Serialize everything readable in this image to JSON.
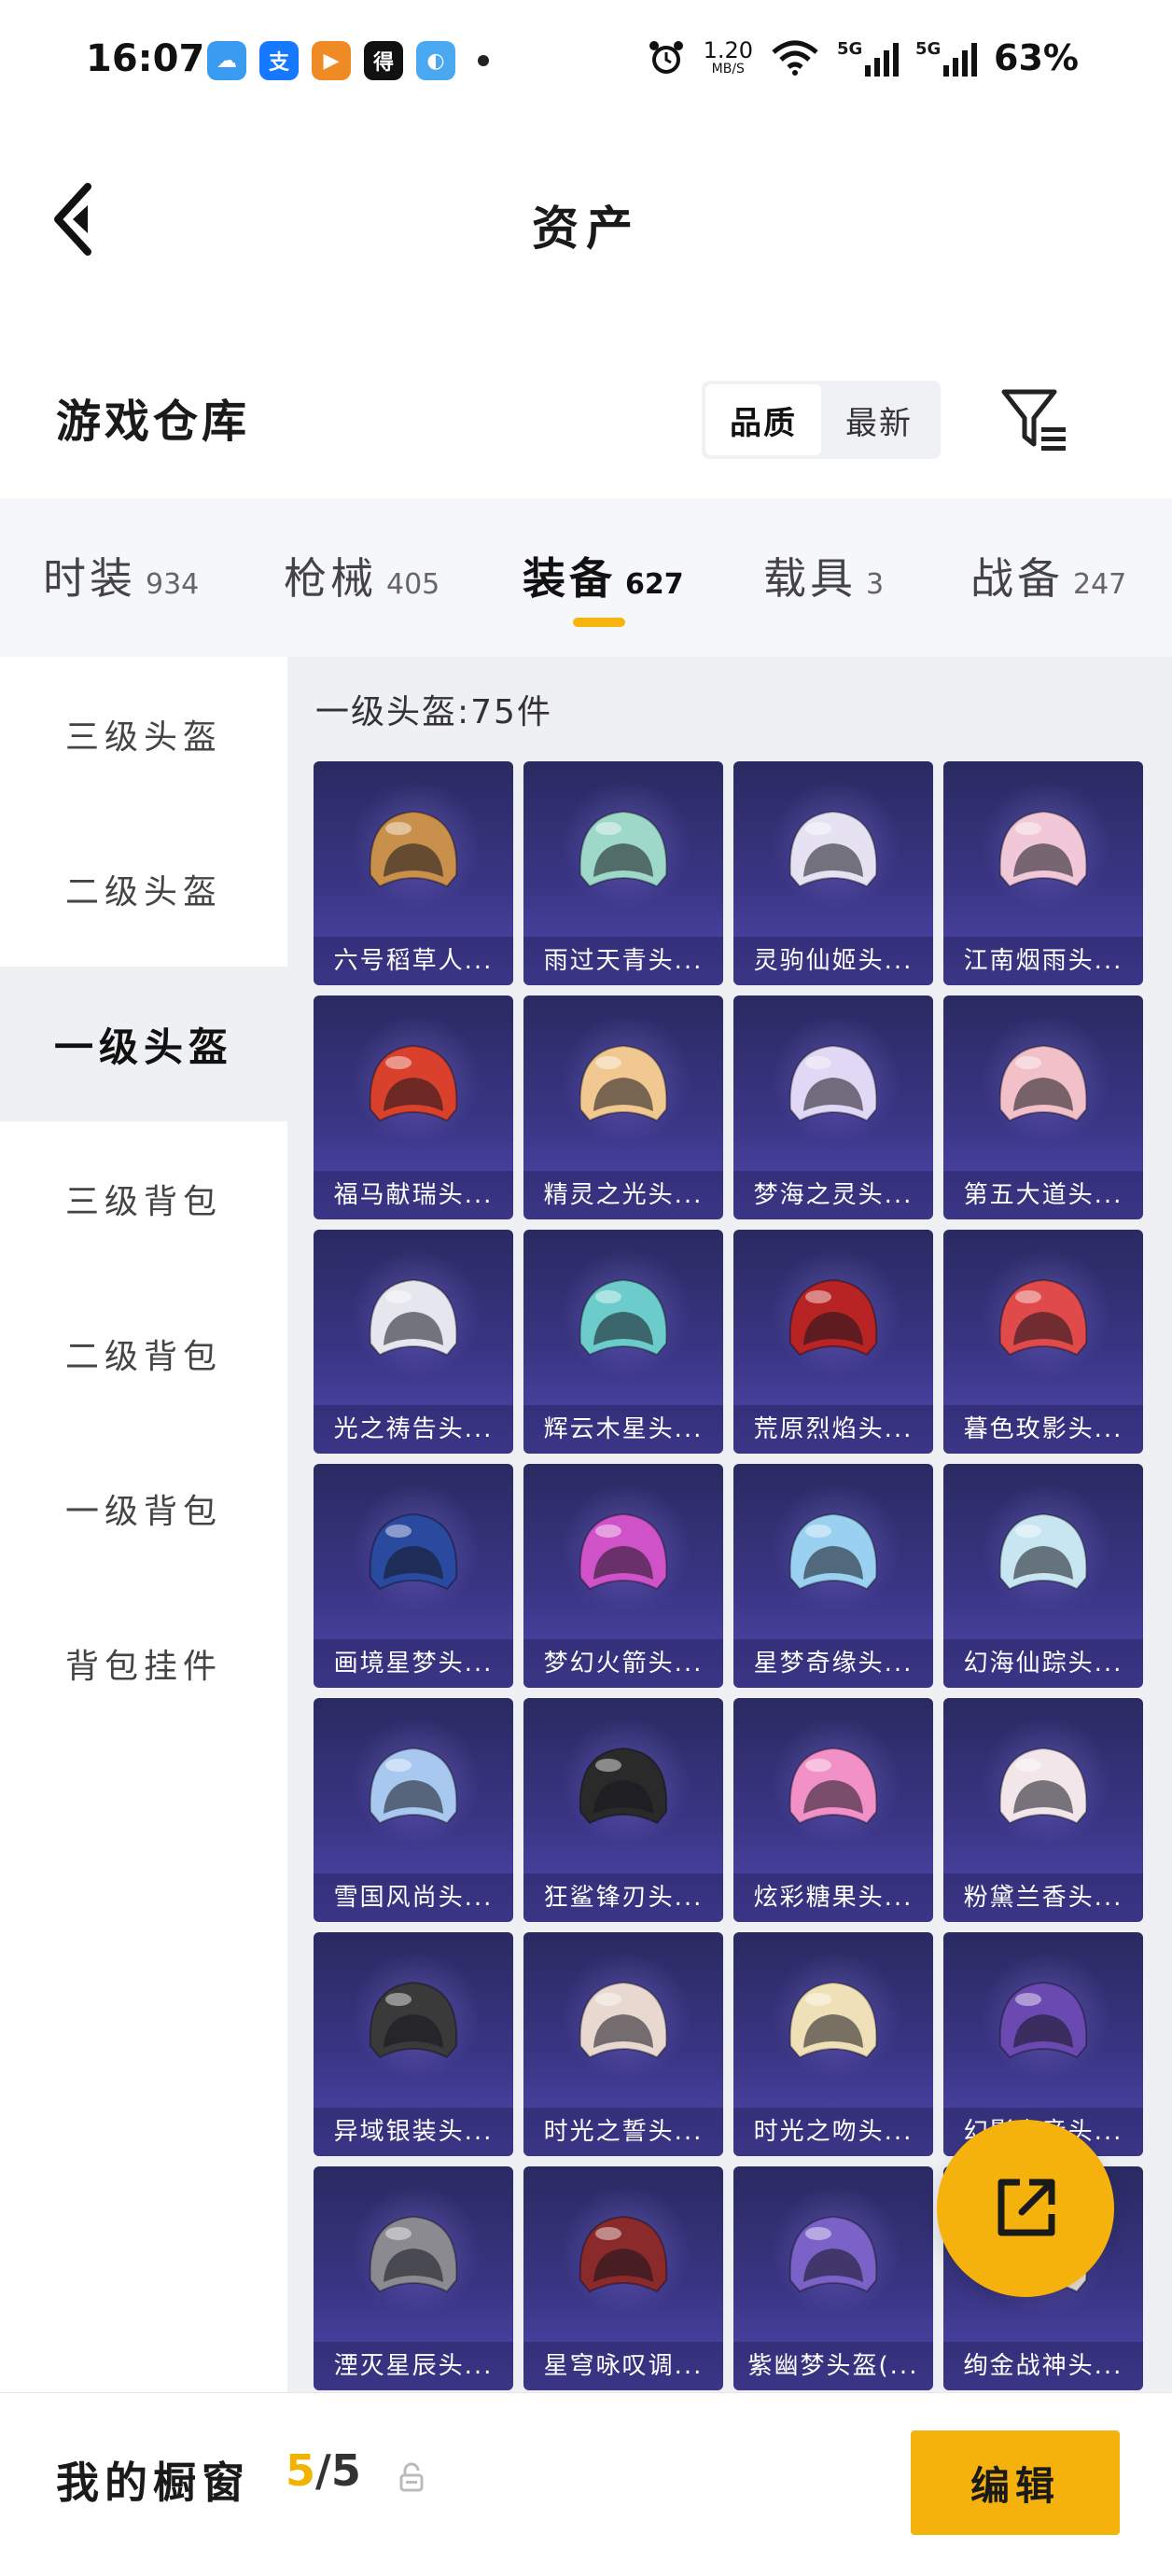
{
  "status_bar": {
    "time": "16:07",
    "app_icons": [
      "weather-icon",
      "alipay-icon",
      "video-app-icon",
      "dewu-icon",
      "qq-browser-icon"
    ],
    "net_speed_value": "1.20",
    "net_speed_unit": "MB/S",
    "sim1_label": "5G",
    "sim2_label": "5G",
    "battery": "63%"
  },
  "header": {
    "title": "资产"
  },
  "warehouse": {
    "title": "游戏仓库",
    "sort_options": [
      "品质",
      "最新"
    ],
    "active_sort": 0
  },
  "categories": [
    {
      "label": "时装",
      "count": "934"
    },
    {
      "label": "枪械",
      "count": "405"
    },
    {
      "label": "装备",
      "count": "627"
    },
    {
      "label": "载具",
      "count": "3"
    },
    {
      "label": "战备",
      "count": "247"
    }
  ],
  "active_category": 2,
  "sidebar": {
    "items": [
      "三级头盔",
      "二级头盔",
      "一级头盔",
      "三级背包",
      "二级背包",
      "一级背包",
      "背包挂件"
    ],
    "active": 2
  },
  "content": {
    "heading": "一级头盔:75件",
    "items": [
      {
        "name": "六号稻草人...",
        "color": "#c8904a"
      },
      {
        "name": "雨过天青头...",
        "color": "#9ed8c8"
      },
      {
        "name": "灵驹仙姬头...",
        "color": "#e6e2f2"
      },
      {
        "name": "江南烟雨头...",
        "color": "#f0c8d8"
      },
      {
        "name": "福马献瑞头...",
        "color": "#d9412c"
      },
      {
        "name": "精灵之光头...",
        "color": "#f0c890"
      },
      {
        "name": "梦海之灵头...",
        "color": "#e0d8f4"
      },
      {
        "name": "第五大道头...",
        "color": "#f2c0c8"
      },
      {
        "name": "光之祷告头...",
        "color": "#e6e6ee"
      },
      {
        "name": "辉云木星头...",
        "color": "#6ccccc"
      },
      {
        "name": "荒原烈焰头...",
        "color": "#b82424"
      },
      {
        "name": "暮色玫影头...",
        "color": "#e04a4a"
      },
      {
        "name": "画境星梦头...",
        "color": "#2a4aa0"
      },
      {
        "name": "梦幻火箭头...",
        "color": "#d052c8"
      },
      {
        "name": "星梦奇缘头...",
        "color": "#9ad0f0"
      },
      {
        "name": "幻海仙踪头...",
        "color": "#c8e6f2"
      },
      {
        "name": "雪国风尚头...",
        "color": "#a8c8f0"
      },
      {
        "name": "狂鲨锋刃头...",
        "color": "#2a2a2a"
      },
      {
        "name": "炫彩糖果头...",
        "color": "#f290c8"
      },
      {
        "name": "粉黛兰香头...",
        "color": "#f2e6ea"
      },
      {
        "name": "异域银装头...",
        "color": "#3a3a3a"
      },
      {
        "name": "时光之誓头...",
        "color": "#e8d8d0"
      },
      {
        "name": "时光之吻头...",
        "color": "#f0e0b8"
      },
      {
        "name": "幻影之音头...",
        "color": "#6a4ab0"
      },
      {
        "name": "湮灭星辰头...",
        "color": "#8a8a90"
      },
      {
        "name": "星穹咏叹调...",
        "color": "#8a2a2a"
      },
      {
        "name": "紫幽梦头盔(...",
        "color": "#7a62c8"
      },
      {
        "name": "绚金战神头...",
        "color": "#e8e2da"
      }
    ]
  },
  "showcase": {
    "label": "我的橱窗",
    "current": "5",
    "separator": "/",
    "total": "5",
    "edit_label": "编辑"
  },
  "colors": {
    "accent": "#f5b20c",
    "card_top": "#2a2a62",
    "card_bottom": "#5148b0"
  }
}
